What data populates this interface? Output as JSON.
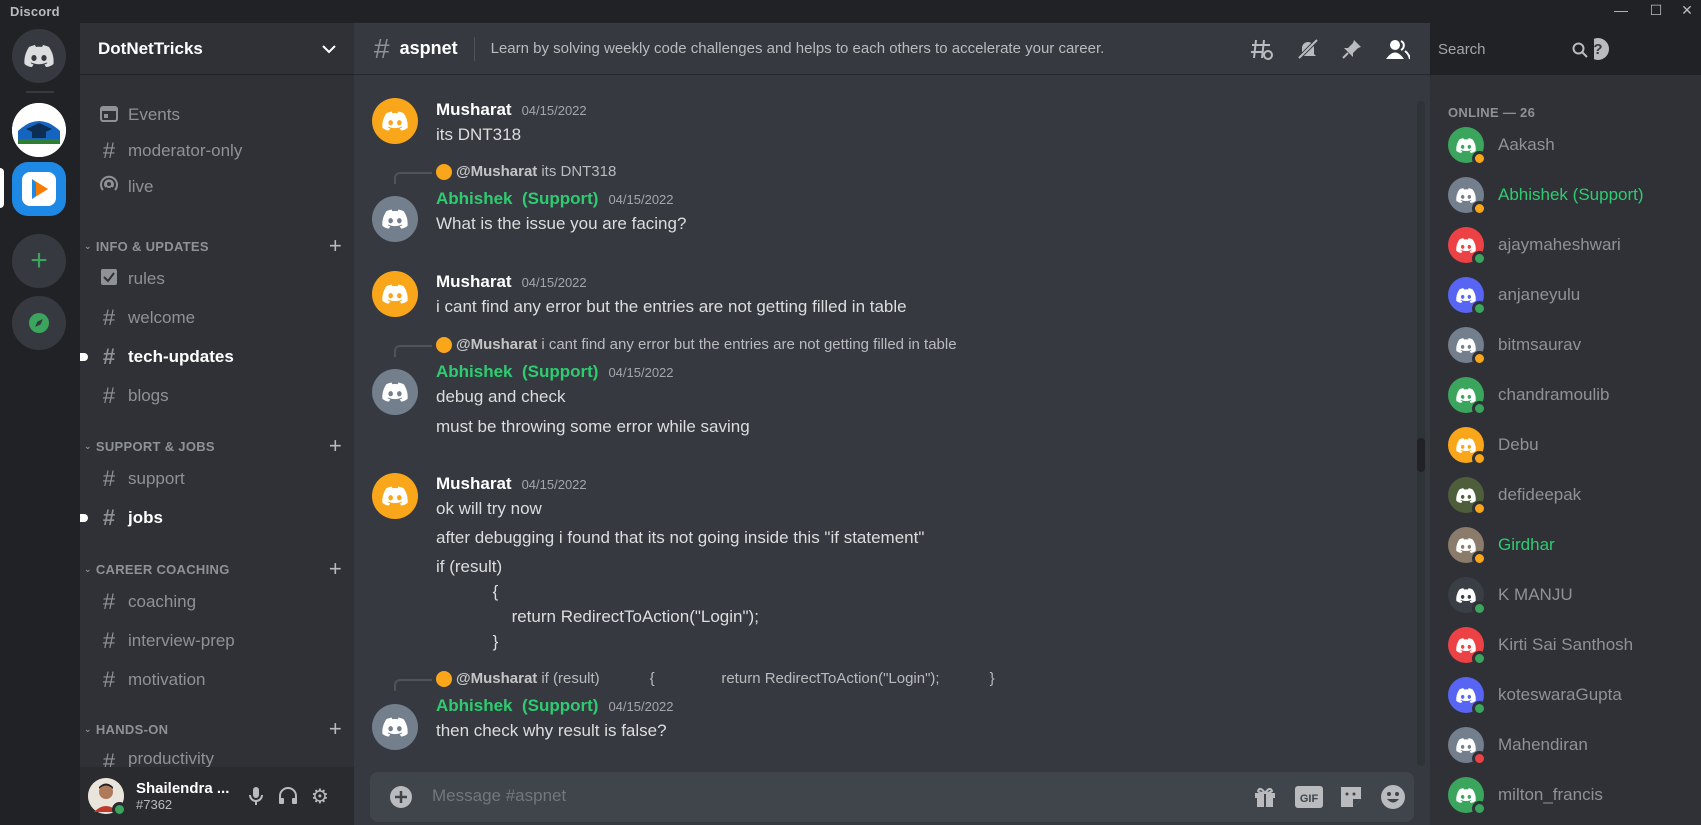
{
  "app": {
    "title": "Discord"
  },
  "colors": {
    "blurple": "#5865f2",
    "green": "#3ba55d",
    "orange": "#faa61a",
    "red": "#ed4245",
    "grey": "#747f8d"
  },
  "guild": {
    "name": "DotNetTricks",
    "top_channels": [
      {
        "icon": "calendar-icon",
        "label": "Events"
      },
      {
        "icon": "locked-hash-icon",
        "label": "moderator-only"
      },
      {
        "icon": "stage-icon",
        "label": "live"
      }
    ],
    "categories": [
      {
        "label": "INFO & UPDATES",
        "channels": [
          {
            "icon": "rules-icon",
            "label": "rules",
            "unread": false
          },
          {
            "icon": "hash-icon",
            "label": "welcome",
            "unread": false
          },
          {
            "icon": "hash-icon",
            "label": "tech-updates",
            "unread": true
          },
          {
            "icon": "hash-icon",
            "label": "blogs",
            "unread": false
          }
        ]
      },
      {
        "label": "SUPPORT & JOBS",
        "channels": [
          {
            "icon": "hash-icon",
            "label": "support",
            "unread": false
          },
          {
            "icon": "hash-icon",
            "label": "jobs",
            "unread": true
          }
        ]
      },
      {
        "label": "CAREER COACHING",
        "channels": [
          {
            "icon": "hash-icon",
            "label": "coaching",
            "unread": false
          },
          {
            "icon": "hash-icon",
            "label": "interview-prep",
            "unread": false
          },
          {
            "icon": "hash-icon",
            "label": "motivation",
            "unread": false
          }
        ]
      },
      {
        "label": "HANDS-ON",
        "channels": [
          {
            "icon": "hash-icon",
            "label": "productivity",
            "unread": false
          }
        ]
      }
    ]
  },
  "user": {
    "name": "Shailendra ...",
    "tag": "#7362"
  },
  "channel": {
    "name": "aspnet",
    "topic": "Learn by solving weekly code challenges and helps to each others to accelerate your career.",
    "search_placeholder": "Search",
    "composer_placeholder": "Message #aspnet"
  },
  "messages": [
    {
      "author": "Musharat",
      "date": "04/15/2022",
      "lines": [
        "its DNT318"
      ],
      "reply": null
    },
    {
      "author": "Abhishek  (Support)",
      "date": "04/15/2022",
      "lines": [
        "What is the issue you are facing?"
      ],
      "reply": {
        "to": "@Musharat",
        "text": "its DNT318"
      }
    },
    {
      "author": "Musharat",
      "date": "04/15/2022",
      "lines": [
        "i cant find any error but the entries are not getting filled in table"
      ],
      "reply": null
    },
    {
      "author": "Abhishek  (Support)",
      "date": "04/15/2022",
      "lines": [
        "debug and check",
        "must be throwing some error while saving"
      ],
      "reply": {
        "to": "@Musharat",
        "text": "i cant find any error but the entries are not getting filled in table"
      }
    },
    {
      "author": "Musharat",
      "date": "04/15/2022",
      "lines": [
        "ok will try now",
        "after debugging i found that its not going inside this \"if statement\"",
        "if (result)",
        "            {",
        "                return RedirectToAction(\"Login\");",
        "            }"
      ],
      "reply": null
    },
    {
      "author": "Abhishek  (Support)",
      "date": "04/15/2022",
      "lines": [
        "then check why result is false?"
      ],
      "reply": {
        "to": "@Musharat",
        "text": "if (result)            {                return RedirectToAction(\"Login\");            }"
      }
    }
  ],
  "members": {
    "header": "ONLINE — 26",
    "list": [
      {
        "name": "Aakash",
        "status": "idle",
        "highlight": false
      },
      {
        "name": "Abhishek (Support)",
        "status": "idle",
        "highlight": true
      },
      {
        "name": "ajaymaheshwari",
        "status": "online",
        "highlight": false
      },
      {
        "name": "anjaneyulu",
        "status": "online",
        "highlight": false
      },
      {
        "name": "bitmsaurav",
        "status": "idle",
        "highlight": false
      },
      {
        "name": "chandramoulib",
        "status": "online",
        "highlight": false
      },
      {
        "name": "Debu",
        "status": "idle",
        "highlight": false
      },
      {
        "name": "defideepak",
        "status": "idle",
        "highlight": false
      },
      {
        "name": "Girdhar",
        "status": "idle",
        "highlight": true
      },
      {
        "name": "K MANJU",
        "status": "online",
        "highlight": false
      },
      {
        "name": "Kirti Sai Santhosh",
        "status": "online",
        "highlight": false
      },
      {
        "name": "koteswaraGupta",
        "status": "online",
        "highlight": false
      },
      {
        "name": "Mahendiran",
        "status": "dnd",
        "highlight": false
      },
      {
        "name": "milton_francis",
        "status": "online",
        "highlight": false
      }
    ]
  }
}
